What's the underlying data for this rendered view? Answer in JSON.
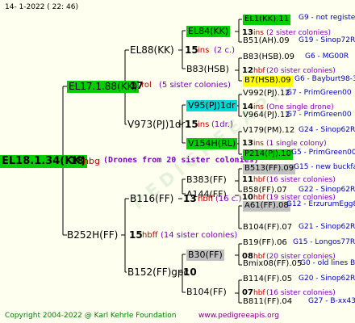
{
  "header": {
    "date": "14-  1-2022 ( 22: 46)"
  },
  "footer": {
    "copyright": "Copyright 2004-2022 @ Karl Kehrle Foundation",
    "site": "www.pedigreeapis.org"
  },
  "colors": {
    "green": "#00d000",
    "cyan": "#00d8d8",
    "yellow": "#ffff00",
    "gray": "#c0c0c0",
    "blue": "#0000c8",
    "red": "#c00000",
    "purple": "#8000c0",
    "olive": "#808000",
    "link": "#800080"
  },
  "root": {
    "id": "EL18.1.34(KK)",
    "year": "18",
    "mark": "hbg",
    "note": "(Drones from 20 sister colonies)"
  },
  "gen1": [
    {
      "id": "EL17.1.88(KK)",
      "year": "17",
      "mark": "rol",
      "note": "(5 sister colonies)"
    },
    {
      "id": "B252H(FF)",
      "year": "15",
      "mark": "hbff",
      "note": "(14 sister colonies)"
    }
  ],
  "gen2": [
    {
      "id": "EL88(KK)",
      "year": "15",
      "mark": "ins",
      "note": "(2 c.)"
    },
    {
      "id": "V973(PJ)1dr",
      "year": "15",
      "mark": "ins",
      "note": "(1dr.)"
    },
    {
      "id": "B116(FF)",
      "year": "13",
      "mark": "hbff",
      "note": "(16 c.)"
    },
    {
      "id": "B152(FF)gpc",
      "year": "10",
      "mark": "",
      "note": ""
    }
  ],
  "gen3": [
    {
      "id": "EL84(KK)",
      "year": "13",
      "mark": "ins",
      "note": "(2 sister colonies)"
    },
    {
      "id": "B83(HSB)",
      "year": "12",
      "mark": "hbf",
      "note": "(20 sister colonies)"
    },
    {
      "id": "V95(PJ)1dr",
      "year": "14",
      "mark": "ins",
      "note": "(One single drone)"
    },
    {
      "id": "V154H(RL)",
      "year": "13",
      "mark": "ins",
      "note": "(1 single colony)"
    },
    {
      "id": "B383(FF)",
      "year": "11",
      "mark": "hbf",
      "note": "(16 sister colonies)"
    },
    {
      "id": "A144(FF)",
      "year": "10",
      "mark": "hbf",
      "note": "(19 sister colonies)"
    },
    {
      "id": "B30(FF)",
      "year": "08",
      "mark": "hbf",
      "note": "(20 sister colonies)"
    },
    {
      "id": "B104(FF)",
      "year": "07",
      "mark": "hbf",
      "note": "(16 sister colonies)"
    }
  ],
  "gen4": [
    {
      "id": "EL1(KK).11",
      "code": "G9 - not registe"
    },
    {
      "id": "B51(AH).09",
      "code": "G19 - Sinop72R"
    },
    {
      "id": "B83(HSB).09",
      "code": "G6 - MG00R"
    },
    {
      "id": "B7(HSB).09",
      "code": "G6 - Bayburt98-3"
    },
    {
      "id": "V992(PJ).12",
      "code": "G7 - PrimGreen00"
    },
    {
      "id": "V964(PJ).12",
      "code": "G7 - PrimGreen00"
    },
    {
      "id": "V179(PM).12",
      "code": "G24 - Sinop62R"
    },
    {
      "id": "P214(PJ).10",
      "code": "G5 - PrimGreen00"
    },
    {
      "id": "B513(FF).09",
      "code": "G15 - new buckfas"
    },
    {
      "id": "B58(FF).07",
      "code": "G22 - Sinop62R"
    },
    {
      "id": "A61(FF).08",
      "code": "G12 - ErzurumEgg8"
    },
    {
      "id": "B104(FF).07",
      "code": "G21 - Sinop62R"
    },
    {
      "id": "B19(FF).06",
      "code": "G15 - Longos77R"
    },
    {
      "id": "Bmix08(FF).05",
      "code": "G0 - old lines B"
    },
    {
      "id": "B114(FF).05",
      "code": "G20 - Sinop62R"
    },
    {
      "id": "B811(FF).04",
      "code": "G27 - B-xx43"
    }
  ]
}
